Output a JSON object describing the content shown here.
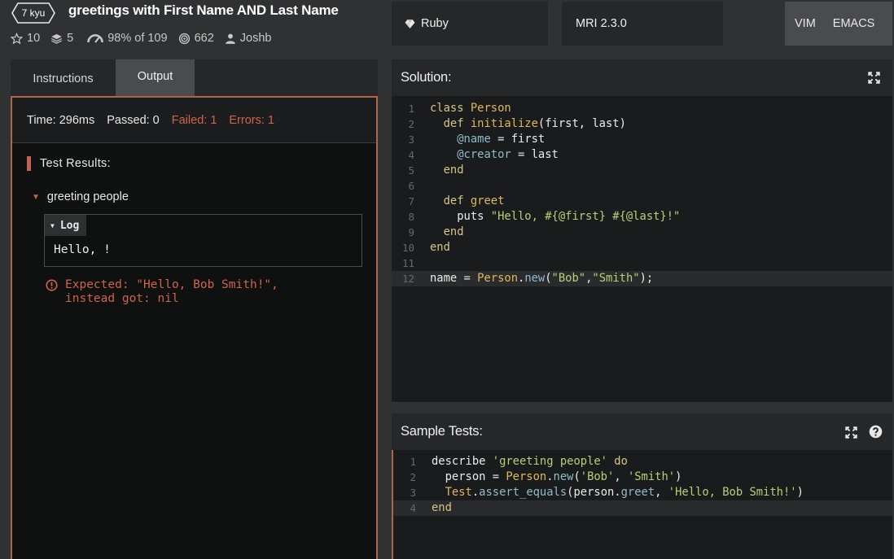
{
  "header": {
    "kyu": "7 kyu",
    "title": "greetings with First Name AND Last Name",
    "stats": {
      "stars": "10",
      "collections": "5",
      "satisfaction": "98%",
      "of_label": "of 109",
      "completed": "662",
      "author": "Joshb"
    }
  },
  "language": {
    "name": "Ruby",
    "version": "MRI 2.3.0"
  },
  "modes": {
    "vim": "VIM",
    "emacs": "EMACS"
  },
  "tabs": {
    "instructions": "Instructions",
    "output": "Output"
  },
  "output": {
    "time": "Time: 296ms",
    "passed": "Passed: 0",
    "failed": "Failed: 1",
    "errors": "Errors: 1",
    "results_heading": "Test Results:",
    "group_name": "greeting people",
    "log_label": "Log",
    "log_text": "Hello, !",
    "error_line1": "Expected: \"Hello, Bob Smith!\",",
    "error_line2": "instead got: nil"
  },
  "solution": {
    "title": "Solution:",
    "lines": [
      {
        "n": "1",
        "parts": [
          {
            "t": "class ",
            "c": "kw"
          },
          {
            "t": "Person",
            "c": "cls"
          }
        ]
      },
      {
        "n": "2",
        "parts": [
          {
            "t": "  def ",
            "c": "kw"
          },
          {
            "t": "initialize",
            "c": "fn"
          },
          {
            "t": "(first, last)",
            "c": ""
          }
        ]
      },
      {
        "n": "3",
        "parts": [
          {
            "t": "    ",
            "c": ""
          },
          {
            "t": "@name",
            "c": "iv"
          },
          {
            "t": " = first",
            "c": ""
          }
        ]
      },
      {
        "n": "4",
        "parts": [
          {
            "t": "    ",
            "c": ""
          },
          {
            "t": "@creator",
            "c": "iv"
          },
          {
            "t": " = last",
            "c": ""
          }
        ]
      },
      {
        "n": "5",
        "parts": [
          {
            "t": "  end",
            "c": "kw"
          }
        ]
      },
      {
        "n": "6",
        "parts": []
      },
      {
        "n": "7",
        "parts": [
          {
            "t": "  def ",
            "c": "kw"
          },
          {
            "t": "greet",
            "c": "fn"
          }
        ]
      },
      {
        "n": "8",
        "parts": [
          {
            "t": "    puts ",
            "c": ""
          },
          {
            "t": "\"Hello, #{@first} #{@last}!\"",
            "c": "str"
          }
        ]
      },
      {
        "n": "9",
        "parts": [
          {
            "t": "  end",
            "c": "kw"
          }
        ]
      },
      {
        "n": "10",
        "parts": [
          {
            "t": "end",
            "c": "kw"
          }
        ]
      },
      {
        "n": "11",
        "parts": []
      },
      {
        "n": "12",
        "parts": [
          {
            "t": "name = ",
            "c": ""
          },
          {
            "t": "Person",
            "c": "cls"
          },
          {
            "t": ".",
            "c": ""
          },
          {
            "t": "new",
            "c": "mth"
          },
          {
            "t": "(",
            "c": ""
          },
          {
            "t": "\"Bob\"",
            "c": "str"
          },
          {
            "t": ",",
            "c": ""
          },
          {
            "t": "\"Smith\"",
            "c": "str"
          },
          {
            "t": ");",
            "c": ""
          }
        ],
        "current": true
      }
    ]
  },
  "tests": {
    "title": "Sample Tests:",
    "lines": [
      {
        "n": "1",
        "parts": [
          {
            "t": "describe ",
            "c": ""
          },
          {
            "t": "'greeting people'",
            "c": "str"
          },
          {
            "t": " do",
            "c": "kw"
          }
        ]
      },
      {
        "n": "2",
        "parts": [
          {
            "t": "  person = ",
            "c": ""
          },
          {
            "t": "Person",
            "c": "cls"
          },
          {
            "t": ".",
            "c": ""
          },
          {
            "t": "new",
            "c": "mth"
          },
          {
            "t": "(",
            "c": ""
          },
          {
            "t": "'Bob'",
            "c": "str"
          },
          {
            "t": ", ",
            "c": ""
          },
          {
            "t": "'Smith'",
            "c": "str"
          },
          {
            "t": ")",
            "c": ""
          }
        ]
      },
      {
        "n": "3",
        "parts": [
          {
            "t": "  ",
            "c": ""
          },
          {
            "t": "Test",
            "c": "cls"
          },
          {
            "t": ".",
            "c": ""
          },
          {
            "t": "assert_equals",
            "c": "mth"
          },
          {
            "t": "(person.",
            "c": ""
          },
          {
            "t": "greet",
            "c": "mth"
          },
          {
            "t": ", ",
            "c": ""
          },
          {
            "t": "'Hello, Bob Smith!'",
            "c": "str"
          },
          {
            "t": ")",
            "c": ""
          }
        ]
      },
      {
        "n": "4",
        "parts": [
          {
            "t": "end",
            "c": "kw"
          }
        ],
        "current": true
      }
    ]
  },
  "icons": {
    "stars": "star-icon",
    "collections": "stack-icon",
    "satisfaction": "gauge-icon",
    "completed": "target-icon",
    "author": "user-icon",
    "ruby": "ruby-icon",
    "fullscreen": "fullscreen-icon",
    "help": "help-icon",
    "error": "error-icon"
  },
  "colors": {
    "accent_failed": "#d0634a",
    "panel_border": "#b4634b"
  }
}
